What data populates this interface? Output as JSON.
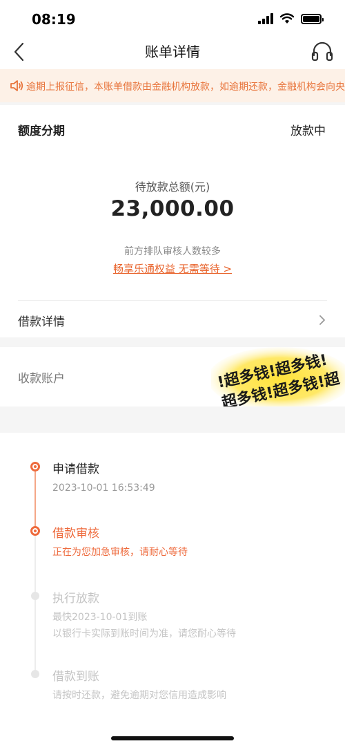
{
  "status_bar": {
    "time": "08:19"
  },
  "nav": {
    "title": "账单详情"
  },
  "notice": {
    "text": "逾期上报征信，本账单借款由金融机构放款，如逾期还款，金融机构会向央"
  },
  "summary": {
    "product_name": "额度分期",
    "status": "放款中",
    "amount_label": "待放款总额(元)",
    "amount": "23,000.00",
    "queue_tip": "前方排队审核人数较多",
    "benefit_link": "畅享乐通权益 无需等待 >",
    "loan_detail_label": "借款详情"
  },
  "account": {
    "label": "收款账户",
    "sticker_line1": "!超多钱!超多钱!",
    "sticker_line2": "超多钱!超多钱!超"
  },
  "timeline": [
    {
      "title": "申请借款",
      "lines": [
        "2023-10-01 16:53:49"
      ],
      "state": "done"
    },
    {
      "title": "借款审核",
      "lines": [
        "正在为您加急审核，请耐心等待"
      ],
      "state": "current"
    },
    {
      "title": "执行放款",
      "lines": [
        "最快2023-10-01到账",
        "以银行卡实际到账时间为准，请您耐心等待"
      ],
      "state": "pending"
    },
    {
      "title": "借款到账",
      "lines": [
        "请按时还款，避免逾期对您信用造成影响"
      ],
      "state": "pending"
    }
  ],
  "colors": {
    "accent": "#ee6a3c",
    "notice_bg": "#fdf1e7",
    "notice_text": "#e8743b",
    "sticker": "#ffe23c"
  },
  "icons": {
    "back": "chevron-left-icon",
    "service": "headset-icon",
    "notice": "speaker-icon",
    "detail": "chevron-right-icon"
  }
}
